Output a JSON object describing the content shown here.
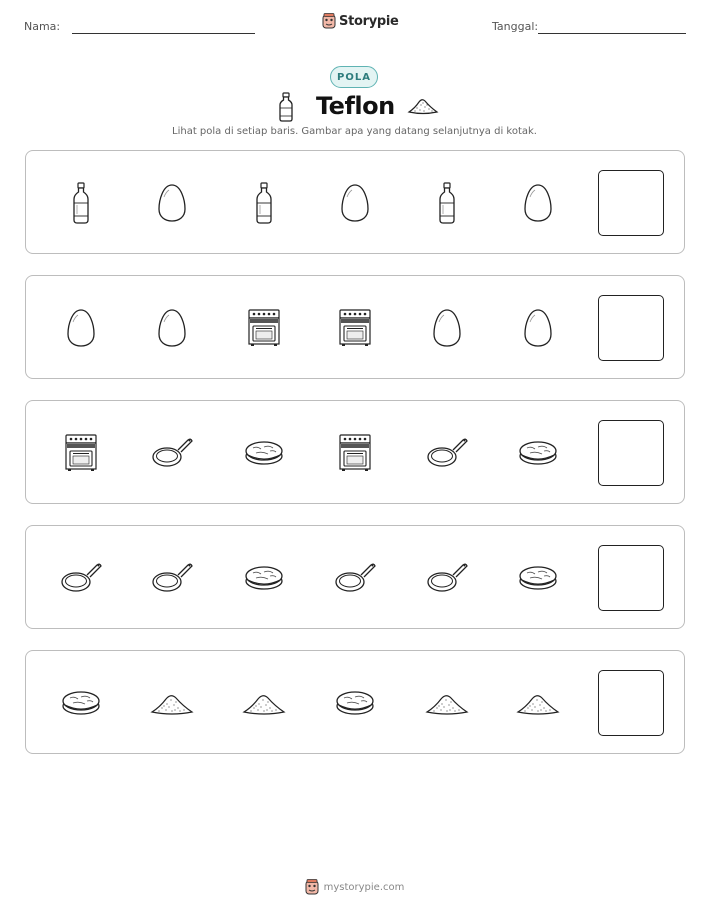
{
  "header": {
    "name_label": "Nama:",
    "date_label": "Tanggal:",
    "brand": "Storypie"
  },
  "badge": "POLA",
  "title": "Teflon",
  "instructions": "Lihat pola di setiap baris. Gambar apa yang datang selanjutnya di kotak.",
  "title_icons": [
    "bottle-icon",
    "powder-pile-icon"
  ],
  "rows": [
    {
      "items": [
        "bottle",
        "egg",
        "bottle",
        "egg",
        "bottle",
        "egg"
      ]
    },
    {
      "items": [
        "egg",
        "egg",
        "stove",
        "stove",
        "egg",
        "egg"
      ]
    },
    {
      "items": [
        "stove",
        "pan",
        "pancake",
        "stove",
        "pan",
        "pancake"
      ]
    },
    {
      "items": [
        "pan",
        "pan",
        "pancake",
        "pan",
        "pan",
        "pancake"
      ]
    },
    {
      "items": [
        "pancake",
        "powder",
        "powder",
        "pancake",
        "powder",
        "powder"
      ]
    }
  ],
  "footer": {
    "url": "mystorypie.com"
  },
  "colors": {
    "badge_border": "#5fb3b3",
    "badge_bg": "#e3f4f3",
    "badge_text": "#2e7d7d"
  }
}
